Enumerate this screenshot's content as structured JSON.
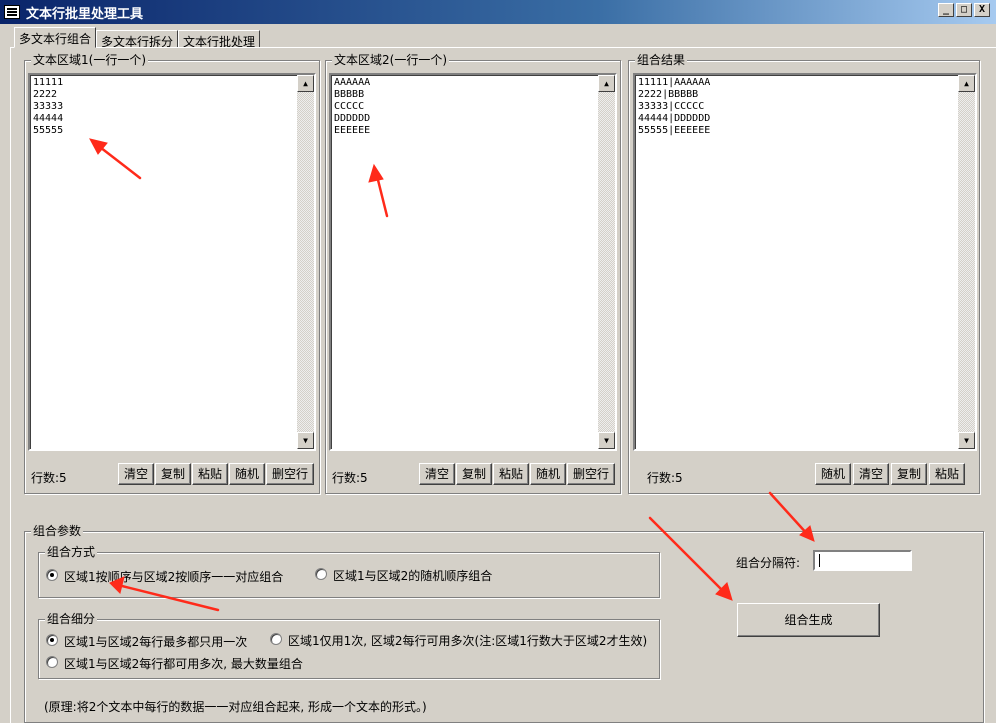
{
  "window": {
    "title": "文本行批里处理工具",
    "controls": {
      "minimize": "_",
      "maximize": "□",
      "close": "X"
    }
  },
  "tabs": [
    {
      "label": "多文本行组合",
      "active": true
    },
    {
      "label": "多文本行拆分",
      "active": false
    },
    {
      "label": "文本行批处理",
      "active": false
    }
  ],
  "area1": {
    "legend": "文本区域1(一行一个)",
    "lines": [
      "11111",
      "2222",
      "33333",
      "44444",
      "55555"
    ],
    "count_label": "行数:5",
    "buttons": [
      "清空",
      "复制",
      "粘贴",
      "随机",
      "删空行"
    ]
  },
  "area2": {
    "legend": "文本区域2(一行一个)",
    "lines": [
      "AAAAAA",
      "BBBBB",
      "CCCCC",
      "DDDDDD",
      "EEEEEE"
    ],
    "count_label": "行数:5",
    "buttons": [
      "清空",
      "复制",
      "粘贴",
      "随机",
      "删空行"
    ]
  },
  "result": {
    "legend": "组合结果",
    "lines": [
      "11111|AAAAAA",
      "2222|BBBBB",
      "33333|CCCCC",
      "44444|DDDDDD",
      "55555|EEEEEE"
    ],
    "count_label": "行数:5",
    "buttons": [
      "随机",
      "清空",
      "复制",
      "粘贴"
    ]
  },
  "params": {
    "legend": "组合参数",
    "mode": {
      "legend": "组合方式",
      "options": [
        {
          "label": "区域1按顺序与区域2按顺序一一对应组合",
          "checked": true
        },
        {
          "label": "区域1与区域2的随机顺序组合",
          "checked": false
        }
      ]
    },
    "detail": {
      "legend": "组合细分",
      "options": [
        {
          "label": "区域1与区域2每行最多都只用一次",
          "checked": true
        },
        {
          "label": "区域1仅用1次, 区域2每行可用多次(注:区域1行数大于区域2才生效)",
          "checked": false
        },
        {
          "label": "区域1与区域2每行都可用多次, 最大数量组合",
          "checked": false
        }
      ]
    },
    "separator_label": "组合分隔符:",
    "separator_value": "|",
    "generate_button": "组合生成",
    "note": "(原理:将2个文本中每行的数据一一对应组合起来, 形成一个文本的形式。)"
  },
  "colors": {
    "annotation_arrow": "#ff2a1a",
    "titlebar": "#0a246a",
    "face": "#d4d0c8"
  }
}
